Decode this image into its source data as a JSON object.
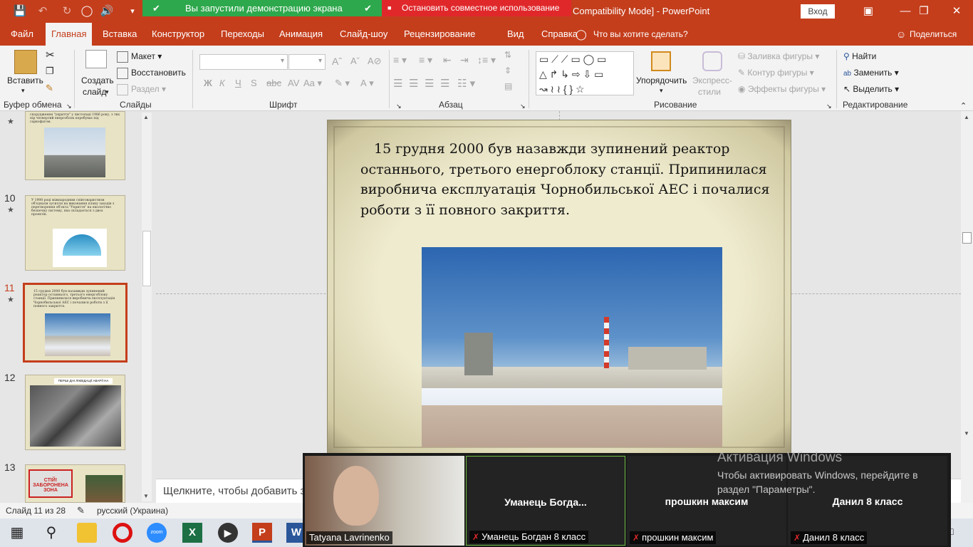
{
  "titlebar": {
    "share_banner": "Вы запустили демонстрацию экрана",
    "stop_share": "Остановить совместное использование",
    "doc_title": "Compatibility Mode]  -  PowerPoint",
    "signin": "Вход"
  },
  "tabs": [
    "Файл",
    "Главная",
    "Вставка",
    "Конструктор",
    "Переходы",
    "Анимация",
    "Слайд-шоу",
    "Рецензирование",
    "Вид",
    "Справка",
    "Что вы хотите сделать?"
  ],
  "share_label": "Поделиться",
  "ribbon": {
    "paste": "Вставить",
    "clipboard": "Буфер обмена",
    "create_slide_1": "Создать",
    "create_slide_2": "слайд",
    "layout": "Макет",
    "reset": "Восстановить",
    "section": "Раздел",
    "slides": "Слайды",
    "font_group": "Шрифт",
    "paragraph_group": "Абзац",
    "arrange": "Упорядочить",
    "quick_styles_1": "Экспресс-",
    "quick_styles_2": "стили",
    "shape_fill": "Заливка фигуры",
    "shape_outline": "Контур фигуры",
    "shape_effects": "Эффекты фигуры",
    "drawing_group": "Рисование",
    "find": "Найти",
    "replace": "Заменить",
    "select": "Выделить",
    "editing_group": "Редактирование",
    "bold": "Ж",
    "italic": "К",
    "underline": "Ч",
    "strike": "S",
    "font_color": "А"
  },
  "thumbnails": [
    {
      "num": "",
      "text": "спорудження \"укриття\" у листопаді 1986 року, з тих пір четвертий енергоблок перебуває під саркофагом."
    },
    {
      "num": "10",
      "text": "У 1998 році міжнародним співтовариством об'єднали зусилля на виконання плану заходів з перетворення об'єкта \"Укриття\" на екологічно безпечну систему, яка складається з двох проектів."
    },
    {
      "num": "11",
      "text": "15 грудня 2000 був назавжди зупинений реактор останнього, третього енергоблоку станції. Припинилася виробнича експлуатація Чорнобильської АЕС і почалися роботи з її повного закриття."
    },
    {
      "num": "12",
      "text": "ПЕРШІ ДНІ ЛІКВІДАЦІЇ АВАРІЇ НА ЧАЕС"
    },
    {
      "num": "13",
      "text": "СТІЙ! ЗАБОРОНЕНА ЗОНА"
    }
  ],
  "slide": {
    "text": "15 грудня 2000 був назавжди зупинений реактор останнього, третього енергоблоку станції. Припинилася виробнича експлуатація Чорнобильської АЕС і почалися роботи з її повного закриття."
  },
  "notes_placeholder": "Щелкните, чтобы добавить за",
  "status": {
    "slide_count": "Слайд 11 из 28",
    "language": "русский (Украина)"
  },
  "zoom": {
    "self_name": "Tatyana Lavrinenko",
    "tiles": [
      {
        "title": "Уманець  Богда...",
        "caption": "Уманець Богдан 8 класс"
      },
      {
        "title": "прошкин максим",
        "caption": "прошкин максим"
      },
      {
        "title": "Данил 8 класс",
        "caption": "Данил 8 класс"
      }
    ]
  },
  "activation": {
    "title": "Активация Windows",
    "line1": "Чтобы активировать Windows, перейдите в",
    "line2": "раздел \"Параметры\"."
  },
  "colors": {
    "ppt_red": "#c43e1c",
    "share_green": "#2ea84c",
    "stop_red": "#e0282b"
  }
}
